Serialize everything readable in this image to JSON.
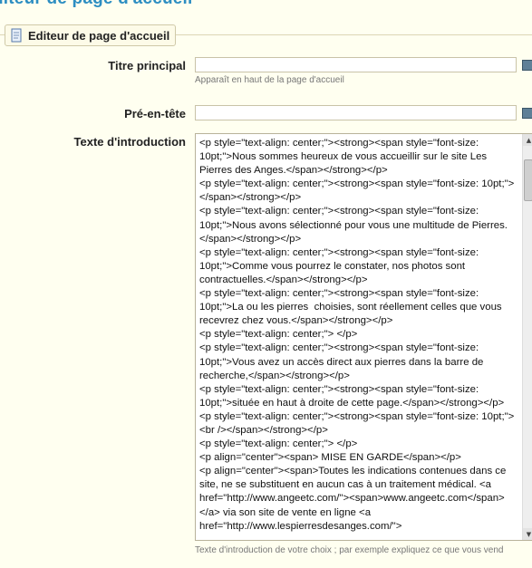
{
  "page": {
    "heading": "diteur de page d'accueil"
  },
  "section": {
    "legend": "Editeur de page d'accueil",
    "icon": "document-icon"
  },
  "fields": {
    "title": {
      "label": "Titre principal",
      "value": "",
      "hint": "Apparaît en haut de la page d'accueil"
    },
    "preheader": {
      "label": "Pré-en-tête",
      "value": ""
    },
    "intro": {
      "label": "Texte d'introduction",
      "value": "<p style=\"text-align: center;\"><strong><span style=\"font-size: 10pt;\">Nous sommes heureux de vous accueillir sur le site Les Pierres des Anges.</span></strong></p>\n<p style=\"text-align: center;\"><strong><span style=\"font-size: 10pt;\"> </span></strong></p>\n<p style=\"text-align: center;\"><strong><span style=\"font-size: 10pt;\">Nous avons sélectionné pour vous une multitude de Pierres.</span></strong></p>\n<p style=\"text-align: center;\"><strong><span style=\"font-size: 10pt;\">Comme vous pourrez le constater, nos photos sont contractuelles.</span></strong></p>\n<p style=\"text-align: center;\"><strong><span style=\"font-size: 10pt;\">La ou les pierres  choisies, sont réellement celles que vous recevrez chez vous.</span></strong></p>\n<p style=\"text-align: center;\"> </p>\n<p style=\"text-align: center;\"><strong><span style=\"font-size: 10pt;\">Vous avez un accès direct aux pierres dans la barre de recherche,</span></strong></p>\n<p style=\"text-align: center;\"><strong><span style=\"font-size: 10pt;\">située en haut à droite de cette page.</span></strong></p>\n<p style=\"text-align: center;\"><strong><span style=\"font-size: 10pt;\"><br /></span></strong></p>\n<p style=\"text-align: center;\"> </p>\n<p align=\"center\"><span> MISE EN GARDE</span></p>\n<p align=\"center\"><span>Toutes les indications contenues dans ce site, ne se substituent en aucun cas à un traitement médical. <a href=\"http://www.angeetc.com/\"><span>www.angeetc.com</span></a> via son site de vente en ligne <a href=\"http://www.lespierresdesanges.com/\">",
      "hint": "Texte d'introduction de votre choix ; par exemple expliquez ce que vous vend"
    }
  },
  "colors": {
    "heading": "#2d8ec2",
    "background": "#fffff0"
  }
}
